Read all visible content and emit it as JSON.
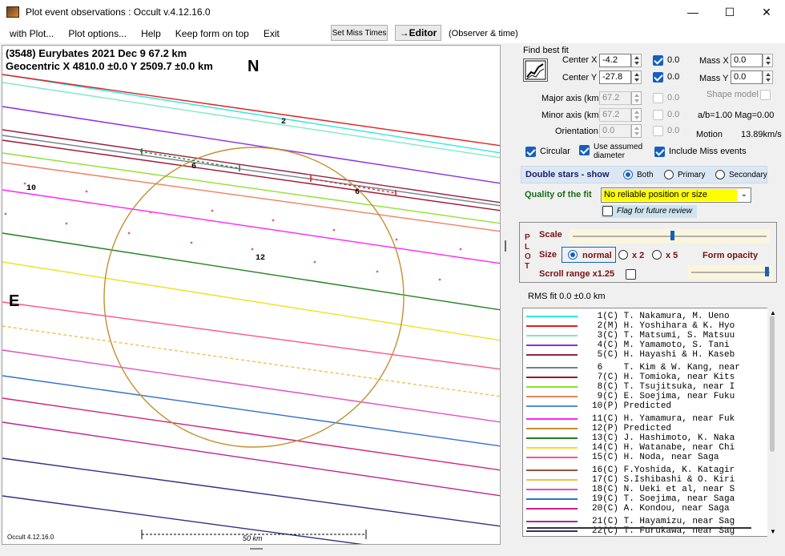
{
  "window": {
    "title": "Plot event observations : Occult v.4.12.16.0"
  },
  "menu": {
    "items": [
      "with Plot...",
      "Plot options...",
      "Help",
      "Keep form on top",
      "Exit"
    ],
    "set_miss_times": "Set Miss Times",
    "editor": "→Editor",
    "observer_time": "(Observer & time)"
  },
  "plot": {
    "header1": "(3548) Eurybates  2021 Dec 9   67.2 km",
    "header2": "Geocentric  X  4810.0 ±0.0  Y 2509.7 ±0.0 km",
    "north": "N",
    "east": "E",
    "version": "Occult 4.12.16.0",
    "scale_label": "50 km",
    "chord_labels": [
      "2",
      "6",
      "6",
      "10",
      "12"
    ]
  },
  "fit": {
    "title": "Find best fit",
    "center_x_label": "Center X",
    "center_x": "-4.2",
    "center_y_label": "Center Y",
    "center_y": "-27.8",
    "cx_check_val": "0.0",
    "cy_check_val": "0.0",
    "mass_x_label": "Mass X",
    "mass_x": "0.0",
    "mass_y_label": "Mass Y",
    "mass_y": "0.0",
    "shape_model": "Shape model",
    "major_label": "Major axis (km)",
    "major": "67.2",
    "major_chk": "0.0",
    "minor_label": "Minor axis (km)",
    "minor": "67.2",
    "minor_chk": "0.0",
    "orient_label": "Orientation",
    "orient": "0.0",
    "orient_chk": "0.0",
    "ab_mag": "a/b=1.00  Mag=0.00",
    "motion_label": "Motion",
    "motion": "13.89km/s",
    "circular": "Circular",
    "assumed_diam": "Use assumed diameter",
    "include_miss": "Include Miss events",
    "double_stars": "Double stars - show",
    "both": "Both",
    "primary": "Primary",
    "secondary": "Secondary",
    "quality_label": "Quality of the fit",
    "quality": "No reliable position or size",
    "flag_review": "Flag for future review"
  },
  "plot_panel": {
    "plot_letters": [
      "P",
      "L",
      "O",
      "T"
    ],
    "scale": "Scale",
    "size": "Size",
    "normal": "normal",
    "x2": "x 2",
    "x5": "x 5",
    "form_opacity": "Form opacity",
    "scroll_range": "Scroll range x1.25"
  },
  "rms": "RMS fit 0.0 ±0.0 km",
  "legend": [
    {
      "num": "1",
      "code": "(C)",
      "name": "T. Nakamura, M. Ueno",
      "color": "#2ee6e6"
    },
    {
      "num": "2",
      "code": "(M)",
      "name": "H. Yoshihara & K. Hyo",
      "color": "#e02020"
    },
    {
      "num": "3",
      "code": "(C)",
      "name": "T. Matsumi, S. Matsuu",
      "color": "#7fe8c8"
    },
    {
      "num": "4",
      "code": "(C)",
      "name": "M. Yamamoto, S. Tani",
      "color": "#8a2be2"
    },
    {
      "num": "5",
      "code": "(C)",
      "name": "H. Hayashi & H. Kaseb",
      "color": "#9a2040"
    },
    {
      "num": "6",
      "code": "",
      "name": "T. Kim & W. Kang, near",
      "color": "#708090"
    },
    {
      "num": "7",
      "code": "(C)",
      "name": "H. Tomioka, near Kits",
      "color": "#a01030"
    },
    {
      "num": "8",
      "code": "(C)",
      "name": "T. Tsujitsuka, near I",
      "color": "#90e030"
    },
    {
      "num": "9",
      "code": "(C)",
      "name": "E. Soejima, near Fuku",
      "color": "#f08060"
    },
    {
      "num": "10",
      "code": "(P)",
      "name": "Predicted",
      "color": "#5090e0"
    },
    {
      "num": "11",
      "code": "(C)",
      "name": "H. Yamamura, near Fuk",
      "color": "#ff20ff"
    },
    {
      "num": "12",
      "code": "(P)",
      "name": "Predicted",
      "color": "#c09030"
    },
    {
      "num": "13",
      "code": "(C)",
      "name": "J. Hashimoto, K. Naka",
      "color": "#208020"
    },
    {
      "num": "14",
      "code": "(C)",
      "name": "H. Watanabe, near Chi",
      "color": "#f0e020"
    },
    {
      "num": "15",
      "code": "(C)",
      "name": "H. Noda, near Saga",
      "color": "#ff5090"
    },
    {
      "num": "16",
      "code": "(C)",
      "name": "F.Yoshida, K. Katagir",
      "color": "#a05040"
    },
    {
      "num": "17",
      "code": "(C)",
      "name": "S.Ishibashi & O. Kiri",
      "color": "#f0c050"
    },
    {
      "num": "18",
      "code": "(C)",
      "name": "N. Ueki et al, near S",
      "color": "#e050c0"
    },
    {
      "num": "19",
      "code": "(C)",
      "name": "T. Soejima, near Saga",
      "color": "#3070d0"
    },
    {
      "num": "20",
      "code": "(C)",
      "name": "A. Kondou, near Saga",
      "color": "#d02080"
    },
    {
      "num": "21",
      "code": "(C)",
      "name": "T. Hayamizu, near Sag",
      "color": "#c02090"
    },
    {
      "num": "22",
      "code": "(C)",
      "name": "T. Furukawa, near Sag",
      "color": "#303080"
    }
  ]
}
